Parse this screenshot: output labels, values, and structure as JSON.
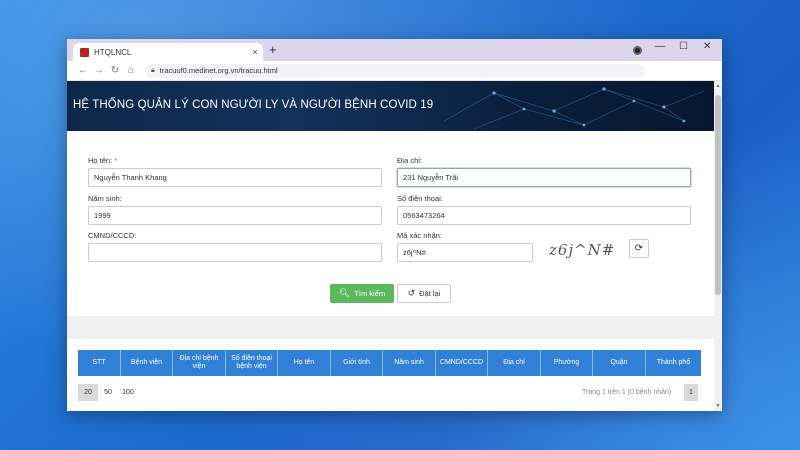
{
  "browser": {
    "tab_title": "HTQLNCL",
    "tab_close": "×",
    "new_tab": "+",
    "url": "tracuuf0.medinet.org.vn/tracuu.html",
    "win_min": "—",
    "win_max": "☐",
    "win_close": "✕"
  },
  "page": {
    "banner_title": "HỆ THỐNG QUẢN LÝ CON NGƯỜI LY VÀ NGƯỜI BỆNH COVID 19"
  },
  "form": {
    "name_label": "Họ tên:",
    "name_required": "*",
    "name_value": "Nguyễn Thanh Khang",
    "address_label": "Địa chỉ:",
    "address_value": "231 Nguyễn Trãi",
    "birth_year_label": "Năm sinh:",
    "birth_year_value": "1999",
    "phone_label": "Số điện thoại:",
    "phone_value": "0563473264",
    "id_label": "CMND/CCCD:",
    "id_value": "",
    "captcha_label": "Mã xác nhận:",
    "captcha_value": "z6j^N#",
    "captcha_image_text": "z6j^N#",
    "search_button": "Tìm kiếm",
    "reset_button": "Đặt lại"
  },
  "table": {
    "columns": [
      "STT",
      "Bệnh viện",
      "Địa chỉ bệnh viện",
      "Số điện thoại bệnh viện",
      "Họ tên",
      "Giới tính",
      "Năm sinh",
      "CMND/CCCD",
      "Địa chỉ",
      "Phường",
      "Quận",
      "Thành phố"
    ],
    "page_sizes": [
      "20",
      "50",
      "100"
    ],
    "page_info": "Trang 1 trên 1 (0 bệnh nhân)",
    "current_page": "1"
  },
  "colors": {
    "header_blue": "#2f80d6",
    "search_green": "#5cb85c",
    "banner_navy": "#0e2748"
  }
}
